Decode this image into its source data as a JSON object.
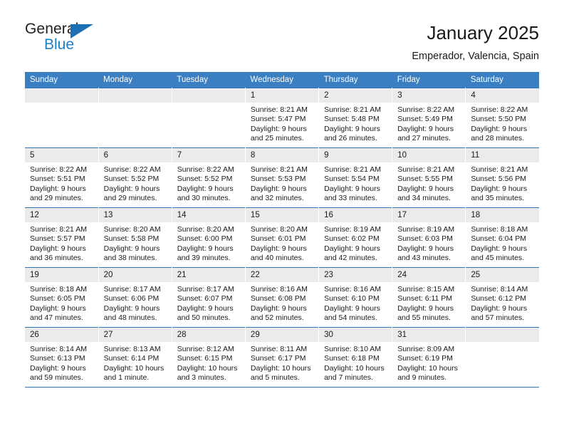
{
  "logo": {
    "word_top": "General",
    "word_bottom": "Blue",
    "triangle_color": "#1b6fb5",
    "blue_color": "#1b7fc3"
  },
  "header": {
    "title": "January 2025",
    "location": "Emperador, Valencia, Spain"
  },
  "theme": {
    "header_blue": "#3a7fc1",
    "border_blue": "#2e75b6",
    "daynum_band": "#ebebeb"
  },
  "weekday_headers": [
    "Sunday",
    "Monday",
    "Tuesday",
    "Wednesday",
    "Thursday",
    "Friday",
    "Saturday"
  ],
  "weeks": [
    [
      {
        "day": "",
        "lines": []
      },
      {
        "day": "",
        "lines": []
      },
      {
        "day": "",
        "lines": []
      },
      {
        "day": "1",
        "lines": [
          "Sunrise: 8:21 AM",
          "Sunset: 5:47 PM",
          "Daylight: 9 hours",
          "and 25 minutes."
        ]
      },
      {
        "day": "2",
        "lines": [
          "Sunrise: 8:21 AM",
          "Sunset: 5:48 PM",
          "Daylight: 9 hours",
          "and 26 minutes."
        ]
      },
      {
        "day": "3",
        "lines": [
          "Sunrise: 8:22 AM",
          "Sunset: 5:49 PM",
          "Daylight: 9 hours",
          "and 27 minutes."
        ]
      },
      {
        "day": "4",
        "lines": [
          "Sunrise: 8:22 AM",
          "Sunset: 5:50 PM",
          "Daylight: 9 hours",
          "and 28 minutes."
        ]
      }
    ],
    [
      {
        "day": "5",
        "lines": [
          "Sunrise: 8:22 AM",
          "Sunset: 5:51 PM",
          "Daylight: 9 hours",
          "and 29 minutes."
        ]
      },
      {
        "day": "6",
        "lines": [
          "Sunrise: 8:22 AM",
          "Sunset: 5:52 PM",
          "Daylight: 9 hours",
          "and 29 minutes."
        ]
      },
      {
        "day": "7",
        "lines": [
          "Sunrise: 8:22 AM",
          "Sunset: 5:52 PM",
          "Daylight: 9 hours",
          "and 30 minutes."
        ]
      },
      {
        "day": "8",
        "lines": [
          "Sunrise: 8:21 AM",
          "Sunset: 5:53 PM",
          "Daylight: 9 hours",
          "and 32 minutes."
        ]
      },
      {
        "day": "9",
        "lines": [
          "Sunrise: 8:21 AM",
          "Sunset: 5:54 PM",
          "Daylight: 9 hours",
          "and 33 minutes."
        ]
      },
      {
        "day": "10",
        "lines": [
          "Sunrise: 8:21 AM",
          "Sunset: 5:55 PM",
          "Daylight: 9 hours",
          "and 34 minutes."
        ]
      },
      {
        "day": "11",
        "lines": [
          "Sunrise: 8:21 AM",
          "Sunset: 5:56 PM",
          "Daylight: 9 hours",
          "and 35 minutes."
        ]
      }
    ],
    [
      {
        "day": "12",
        "lines": [
          "Sunrise: 8:21 AM",
          "Sunset: 5:57 PM",
          "Daylight: 9 hours",
          "and 36 minutes."
        ]
      },
      {
        "day": "13",
        "lines": [
          "Sunrise: 8:20 AM",
          "Sunset: 5:58 PM",
          "Daylight: 9 hours",
          "and 38 minutes."
        ]
      },
      {
        "day": "14",
        "lines": [
          "Sunrise: 8:20 AM",
          "Sunset: 6:00 PM",
          "Daylight: 9 hours",
          "and 39 minutes."
        ]
      },
      {
        "day": "15",
        "lines": [
          "Sunrise: 8:20 AM",
          "Sunset: 6:01 PM",
          "Daylight: 9 hours",
          "and 40 minutes."
        ]
      },
      {
        "day": "16",
        "lines": [
          "Sunrise: 8:19 AM",
          "Sunset: 6:02 PM",
          "Daylight: 9 hours",
          "and 42 minutes."
        ]
      },
      {
        "day": "17",
        "lines": [
          "Sunrise: 8:19 AM",
          "Sunset: 6:03 PM",
          "Daylight: 9 hours",
          "and 43 minutes."
        ]
      },
      {
        "day": "18",
        "lines": [
          "Sunrise: 8:18 AM",
          "Sunset: 6:04 PM",
          "Daylight: 9 hours",
          "and 45 minutes."
        ]
      }
    ],
    [
      {
        "day": "19",
        "lines": [
          "Sunrise: 8:18 AM",
          "Sunset: 6:05 PM",
          "Daylight: 9 hours",
          "and 47 minutes."
        ]
      },
      {
        "day": "20",
        "lines": [
          "Sunrise: 8:17 AM",
          "Sunset: 6:06 PM",
          "Daylight: 9 hours",
          "and 48 minutes."
        ]
      },
      {
        "day": "21",
        "lines": [
          "Sunrise: 8:17 AM",
          "Sunset: 6:07 PM",
          "Daylight: 9 hours",
          "and 50 minutes."
        ]
      },
      {
        "day": "22",
        "lines": [
          "Sunrise: 8:16 AM",
          "Sunset: 6:08 PM",
          "Daylight: 9 hours",
          "and 52 minutes."
        ]
      },
      {
        "day": "23",
        "lines": [
          "Sunrise: 8:16 AM",
          "Sunset: 6:10 PM",
          "Daylight: 9 hours",
          "and 54 minutes."
        ]
      },
      {
        "day": "24",
        "lines": [
          "Sunrise: 8:15 AM",
          "Sunset: 6:11 PM",
          "Daylight: 9 hours",
          "and 55 minutes."
        ]
      },
      {
        "day": "25",
        "lines": [
          "Sunrise: 8:14 AM",
          "Sunset: 6:12 PM",
          "Daylight: 9 hours",
          "and 57 minutes."
        ]
      }
    ],
    [
      {
        "day": "26",
        "lines": [
          "Sunrise: 8:14 AM",
          "Sunset: 6:13 PM",
          "Daylight: 9 hours",
          "and 59 minutes."
        ]
      },
      {
        "day": "27",
        "lines": [
          "Sunrise: 8:13 AM",
          "Sunset: 6:14 PM",
          "Daylight: 10 hours",
          "and 1 minute."
        ]
      },
      {
        "day": "28",
        "lines": [
          "Sunrise: 8:12 AM",
          "Sunset: 6:15 PM",
          "Daylight: 10 hours",
          "and 3 minutes."
        ]
      },
      {
        "day": "29",
        "lines": [
          "Sunrise: 8:11 AM",
          "Sunset: 6:17 PM",
          "Daylight: 10 hours",
          "and 5 minutes."
        ]
      },
      {
        "day": "30",
        "lines": [
          "Sunrise: 8:10 AM",
          "Sunset: 6:18 PM",
          "Daylight: 10 hours",
          "and 7 minutes."
        ]
      },
      {
        "day": "31",
        "lines": [
          "Sunrise: 8:09 AM",
          "Sunset: 6:19 PM",
          "Daylight: 10 hours",
          "and 9 minutes."
        ]
      },
      {
        "day": "",
        "lines": []
      }
    ]
  ]
}
